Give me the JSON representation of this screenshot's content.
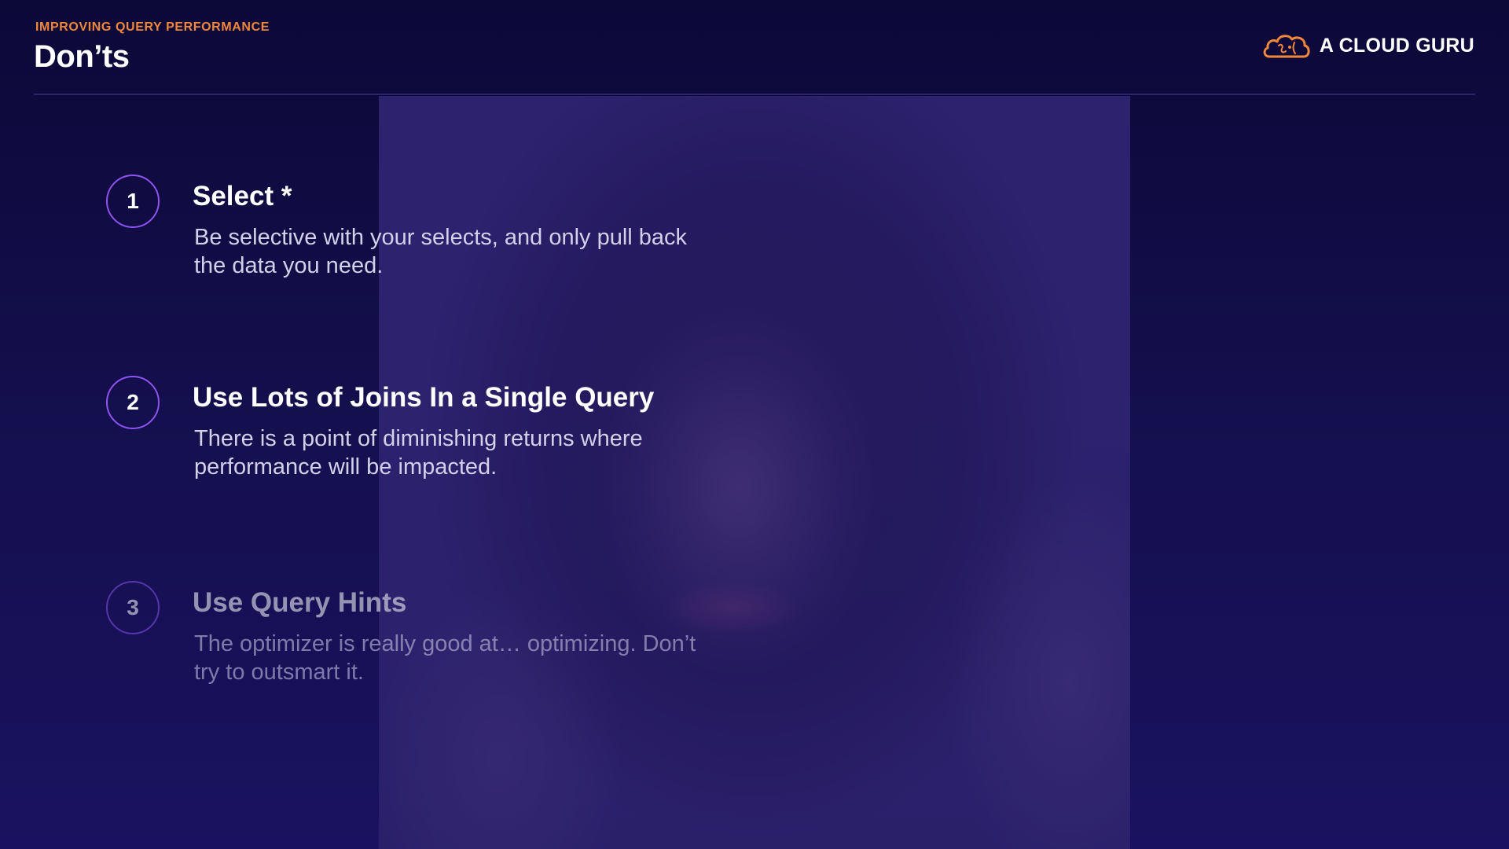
{
  "header": {
    "eyebrow": "IMPROVING QUERY PERFORMANCE",
    "title": "Don’ts"
  },
  "brand": {
    "name": "A CLOUD GURU",
    "logo_icon": "cloud-logo-icon",
    "accent_color": "#f0873a"
  },
  "items": [
    {
      "number": "1",
      "title": "Select *",
      "description": "Be selective with your selects, and only pull back the data you need."
    },
    {
      "number": "2",
      "title": "Use Lots of Joins In a Single Query",
      "description": "There is a point of diminishing returns where performance will be impacted."
    },
    {
      "number": "3",
      "title": "Use Query Hints",
      "description": "The optimizer is really good at… optimizing. Don’t try to outsmart it."
    }
  ],
  "colors": {
    "background": "#140f4c",
    "circle_border": "#8c53ef",
    "body_text": "#d3d0ea"
  }
}
